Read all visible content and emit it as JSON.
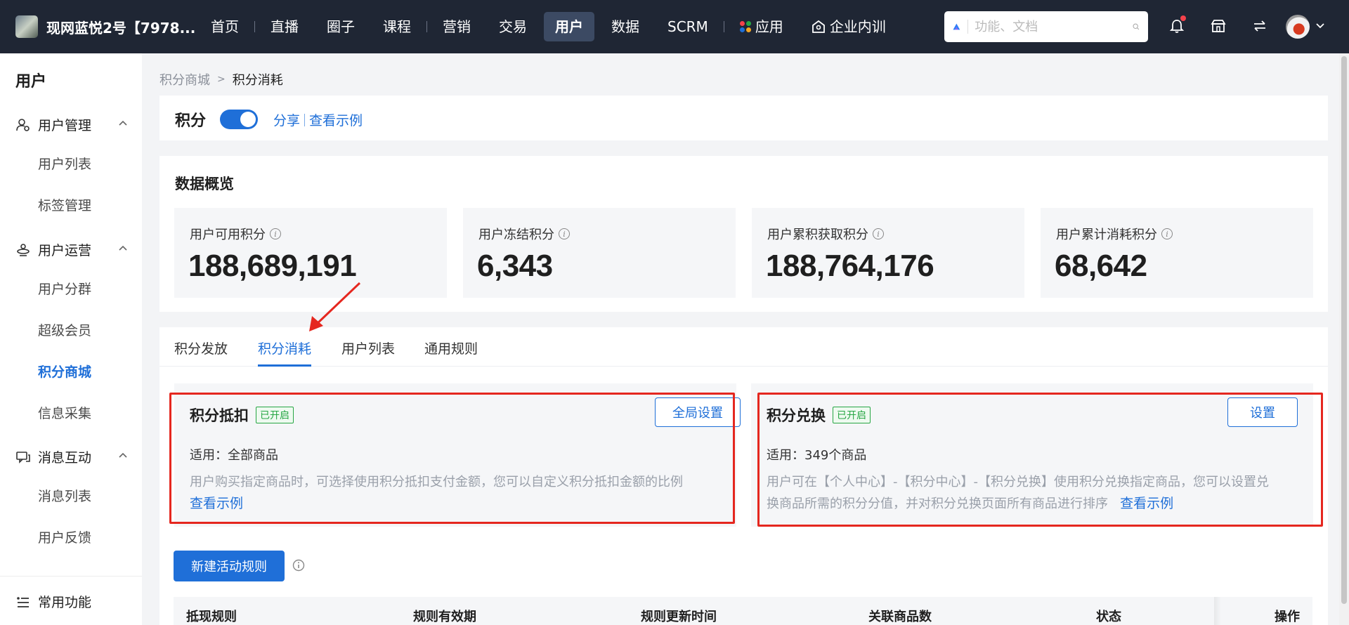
{
  "topbar": {
    "shop_name": "现网蓝悦2号【7978...",
    "nav": [
      "首页",
      "直播",
      "圈子",
      "课程",
      "营销",
      "交易",
      "用户",
      "数据",
      "SCRM",
      "应用",
      "企业内训"
    ],
    "active_nav": "用户",
    "search_placeholder": "功能、文档"
  },
  "sidebar": {
    "title": "用户",
    "groups": [
      {
        "label": "用户管理",
        "icon": "user-gear-icon",
        "items": [
          "用户列表",
          "标签管理"
        ]
      },
      {
        "label": "用户运营",
        "icon": "ops-icon",
        "items": [
          "用户分群",
          "超级会员",
          "积分商城",
          "信息采集"
        ]
      },
      {
        "label": "消息互动",
        "icon": "message-icon",
        "items": [
          "消息列表",
          "用户反馈"
        ]
      }
    ],
    "active_item": "积分商城",
    "bottom_label": "常用功能"
  },
  "breadcrumb": {
    "parent": "积分商城",
    "current": "积分消耗"
  },
  "points": {
    "title": "积分",
    "share": "分享",
    "example": "查看示例"
  },
  "overview": {
    "title": "数据概览",
    "stats": [
      {
        "label": "用户可用积分",
        "value": "188,689,191"
      },
      {
        "label": "用户冻结积分",
        "value": "6,343"
      },
      {
        "label": "用户累积获取积分",
        "value": "188,764,176"
      },
      {
        "label": "用户累计消耗积分",
        "value": "68,642"
      }
    ]
  },
  "tabs": [
    "积分发放",
    "积分消耗",
    "用户列表",
    "通用规则"
  ],
  "active_tab": "积分消耗",
  "features": [
    {
      "title": "积分抵扣",
      "badge": "已开启",
      "button": "全局设置",
      "scope": "适用：全部商品",
      "desc1": "用户购买指定商品时，可选择使用积分抵扣支付金额，您可以自定义积分抵扣金额的比例",
      "desc2": "",
      "link": "查看示例"
    },
    {
      "title": "积分兑换",
      "badge": "已开启",
      "button": "设置",
      "scope": "适用：349个商品",
      "desc1": "用户可在【个人中心】-【积分中心】-【积分兑换】使用积分兑换指定商品，您可以设置兑",
      "desc2": "换商品所需的积分分值，并对积分兑换页面所有商品进行排序",
      "link": "查看示例"
    }
  ],
  "new_rule_button": "新建活动规则",
  "table": {
    "columns": [
      "抵现规则",
      "规则有效期",
      "规则更新时间",
      "关联商品数",
      "状态",
      "操作"
    ]
  },
  "colors": {
    "topbar": "#1f2634",
    "primary": "#1f6fd8",
    "highlight": "#e5271f",
    "success": "#27a644"
  }
}
